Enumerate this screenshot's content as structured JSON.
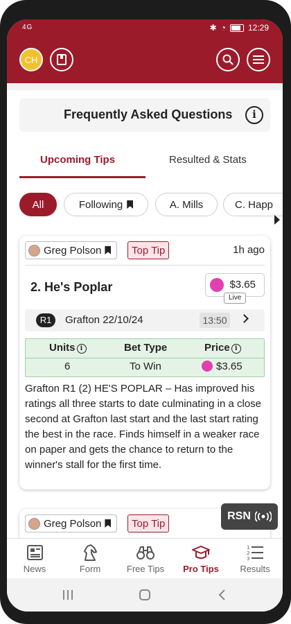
{
  "status_bar": {
    "network": "4G",
    "time": "12:29"
  },
  "header": {
    "avatar_initials": "CH"
  },
  "faq": {
    "title": "Frequently Asked Questions"
  },
  "tabs": [
    {
      "label": "Upcoming Tips",
      "active": true
    },
    {
      "label": "Resulted & Stats",
      "active": false
    }
  ],
  "filters": [
    {
      "label": "All",
      "active": true
    },
    {
      "label": "Following"
    },
    {
      "label": "A. Mills"
    },
    {
      "label": "C. Happ"
    }
  ],
  "tip_card": {
    "author": "Greg Polson",
    "badge": "Top Tip",
    "time_ago": "1h ago",
    "runner": "2. He's Poplar",
    "odds": "$3.65",
    "odds_status": "Live",
    "race_badge": "R1",
    "race_name": "Grafton 22/10/24",
    "race_time": "13:50",
    "table": {
      "headers": [
        "Units",
        "Bet Type",
        "Price"
      ],
      "row": [
        "6",
        "To Win",
        "$3.65"
      ]
    },
    "description": "Grafton R1 (2) HE'S POPLAR – Has improved his ratings all three starts to date culminating in a close second at Grafton last start and the last start rating the best in the race. Finds himself in a weaker race on paper and gets the chance to return to the winner's stall for the first time."
  },
  "tip_card_2": {
    "author": "Greg Polson",
    "badge": "Top Tip"
  },
  "rsn": {
    "label": "RSN"
  },
  "bottom_nav": [
    {
      "label": "News",
      "icon": "news-icon"
    },
    {
      "label": "Form",
      "icon": "horse-icon"
    },
    {
      "label": "Free Tips",
      "icon": "binoculars-icon"
    },
    {
      "label": "Pro Tips",
      "icon": "graduation-cap-icon",
      "active": true
    },
    {
      "label": "Results",
      "icon": "list-numbers-icon"
    }
  ],
  "colors": {
    "brand": "#9c1b2b",
    "accent_gold": "#f2c12e",
    "odds_pink": "#e23fb0",
    "table_green": "#e4f3e6"
  }
}
